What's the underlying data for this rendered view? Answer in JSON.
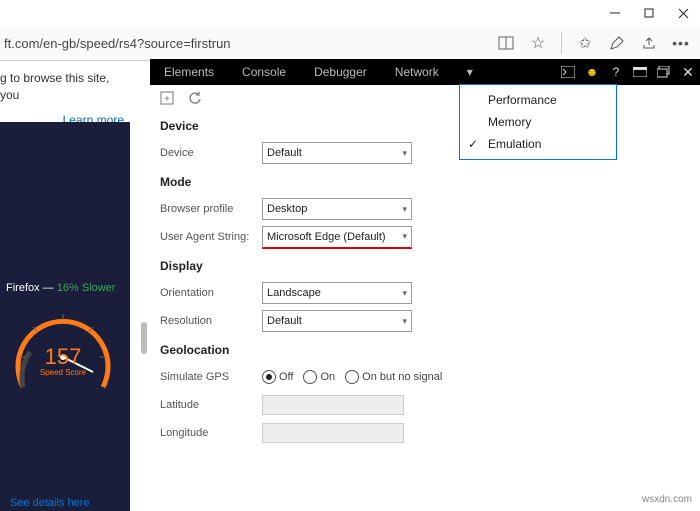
{
  "titlebar": {
    "tooltip_min": "Minimize",
    "tooltip_max": "Maximize",
    "tooltip_close": "Close"
  },
  "address": {
    "url": "ft.com/en-gb/speed/rs4?source=firstrun"
  },
  "site_info": {
    "text": "g to browse this site, you",
    "learn_more": "Learn more"
  },
  "dark": {
    "firefox_label": "Firefox —",
    "firefox_pct": "16% Slower",
    "score": "157",
    "score_label": "Speed Score",
    "details": "See details here"
  },
  "devtools": {
    "tabs": [
      "Elements",
      "Console",
      "Debugger",
      "Network"
    ],
    "dropdown": {
      "items": [
        "Performance",
        "Memory",
        "Emulation"
      ],
      "checked_index": 2
    }
  },
  "panel": {
    "device": {
      "heading": "Device",
      "label": "Device",
      "value": "Default"
    },
    "mode": {
      "heading": "Mode",
      "profile_label": "Browser profile",
      "profile_value": "Desktop",
      "ua_label": "User Agent String:",
      "ua_value": "Microsoft Edge (Default)"
    },
    "display": {
      "heading": "Display",
      "orientation_label": "Orientation",
      "orientation_value": "Landscape",
      "resolution_label": "Resolution",
      "resolution_value": "Default"
    },
    "geo": {
      "heading": "Geolocation",
      "gps_label": "Simulate GPS",
      "opt_off": "Off",
      "opt_on": "On",
      "opt_nosig": "On but no signal",
      "lat_label": "Latitude",
      "lon_label": "Longitude"
    }
  },
  "watermark": "wsxdn.com"
}
